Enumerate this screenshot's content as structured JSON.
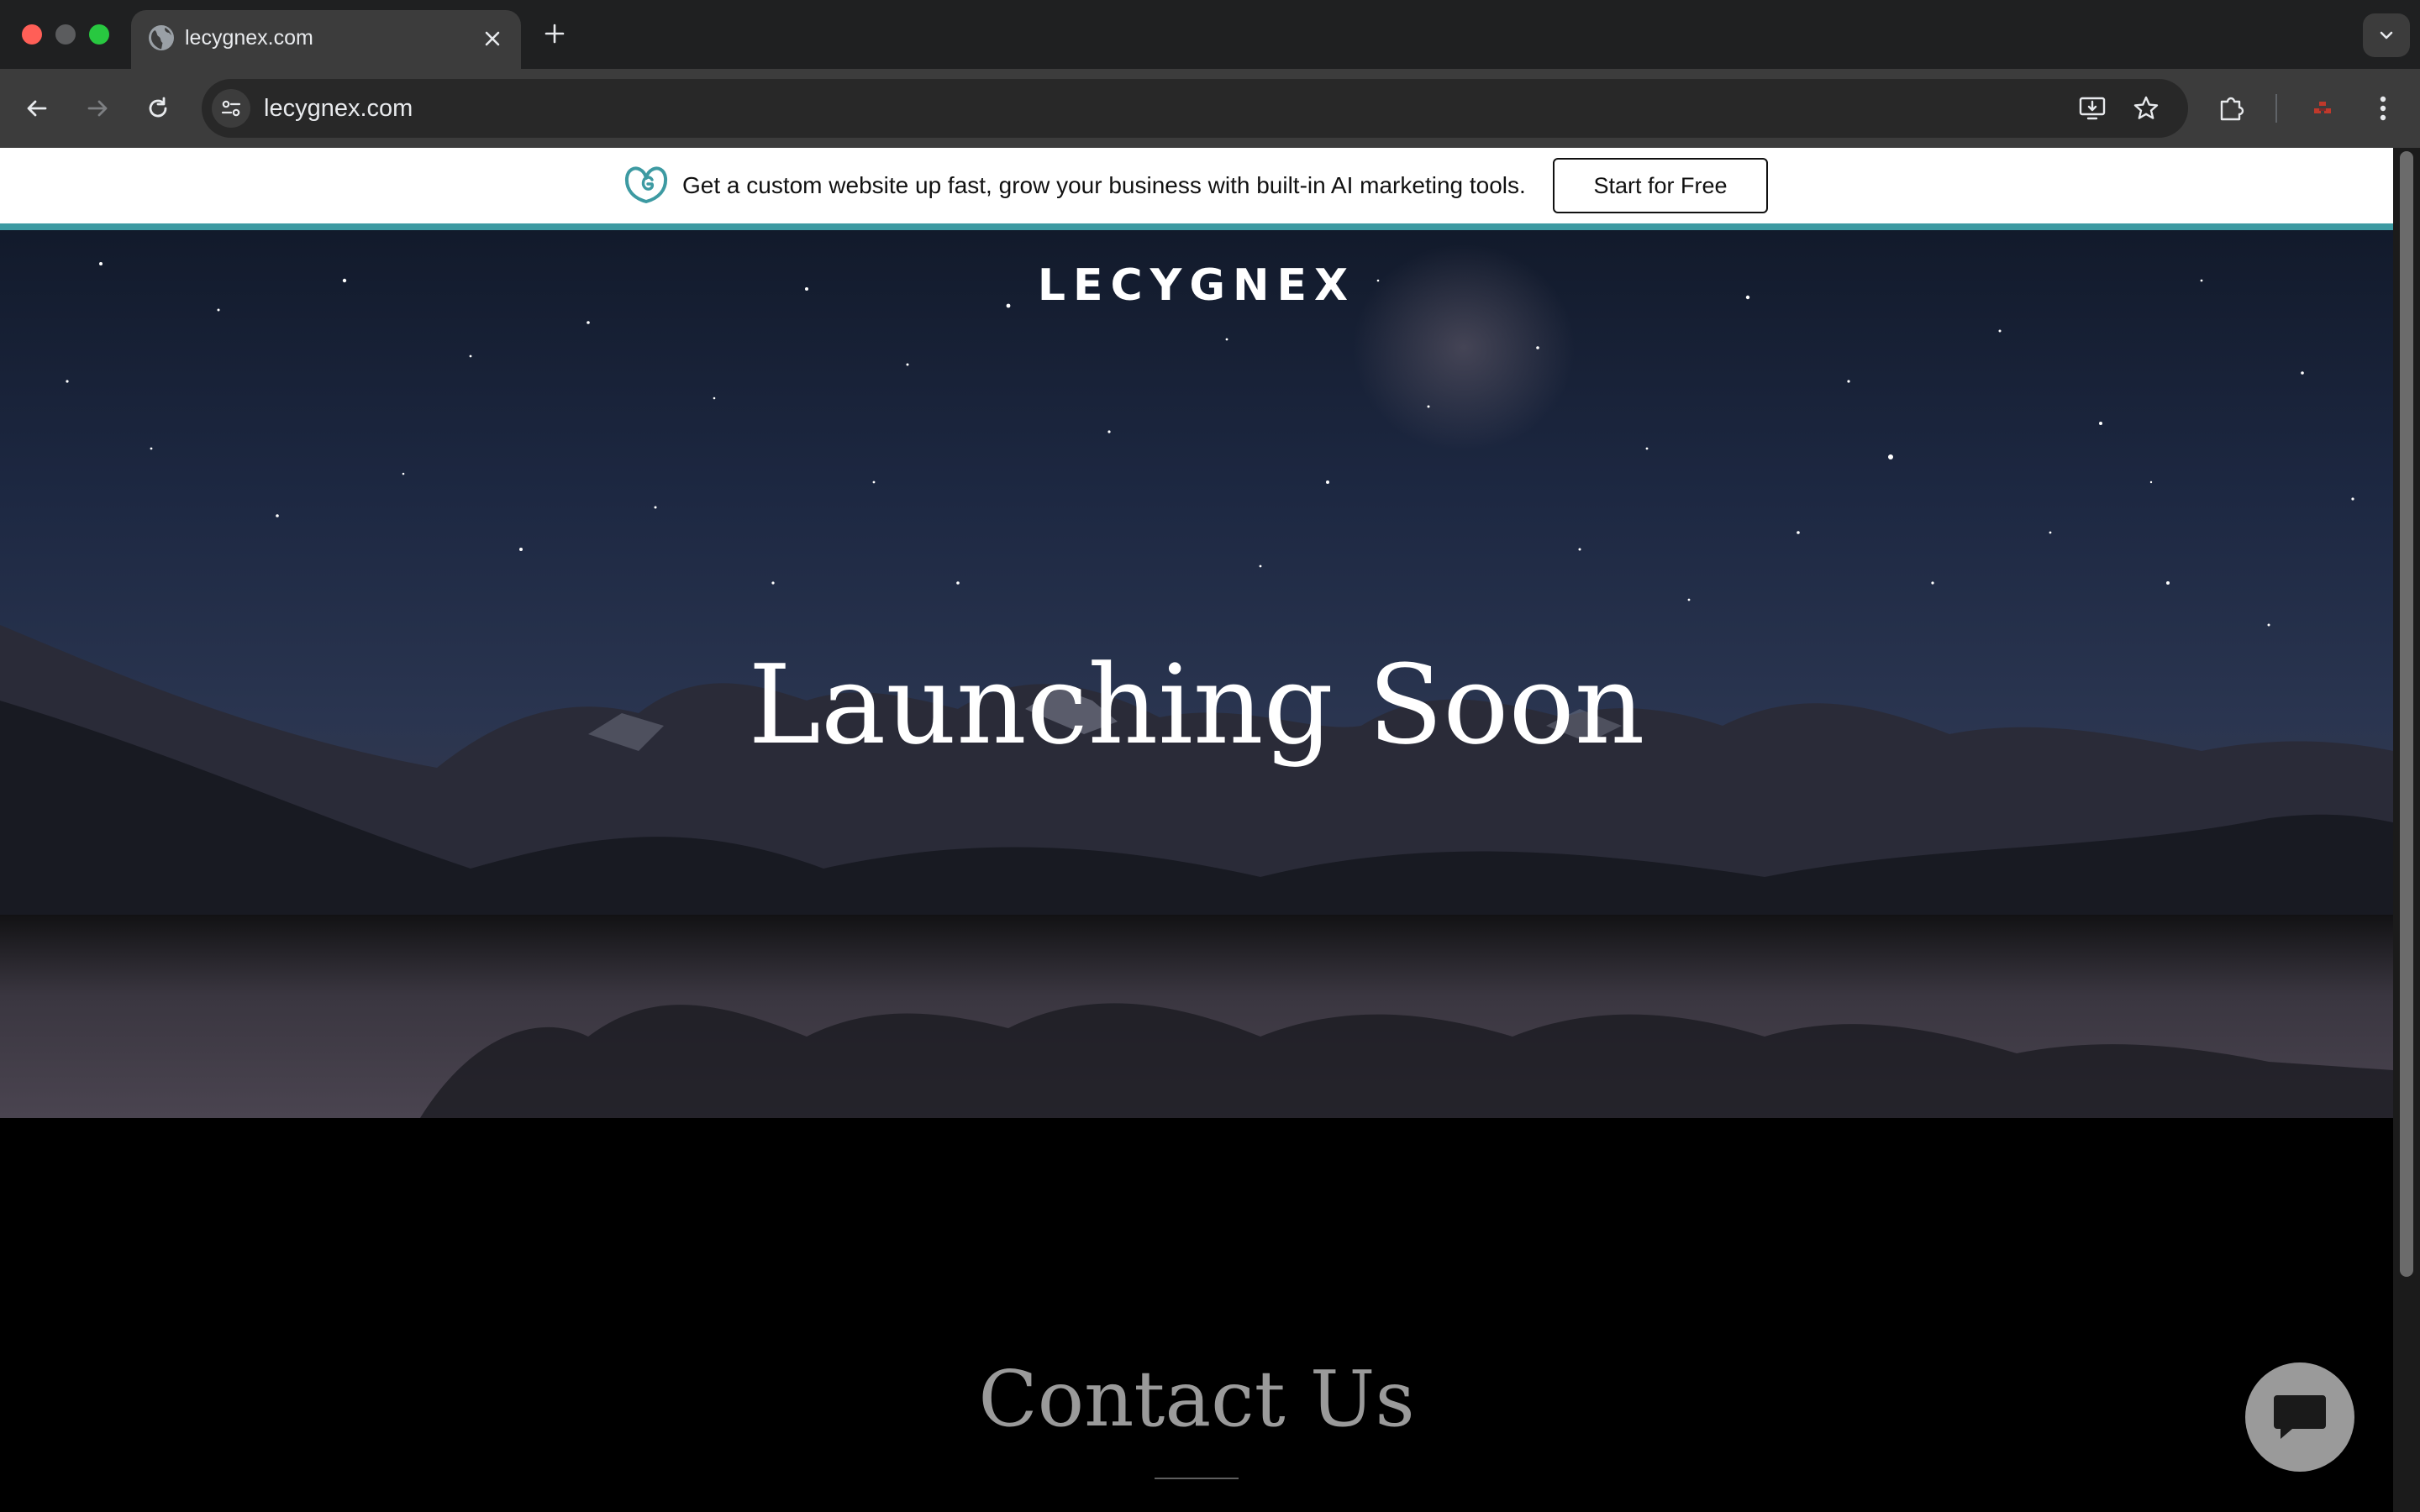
{
  "browser": {
    "tab_title": "lecygnex.com",
    "url": "lecygnex.com",
    "icons": {
      "favicon": "globe-icon",
      "tab_close": "close-icon",
      "new_tab": "plus-icon",
      "tab_list": "chevron-down-icon",
      "back": "back-arrow-icon",
      "forward": "forward-arrow-icon",
      "reload": "reload-icon",
      "site_info": "tune-icon",
      "install": "install-app-icon",
      "bookmark": "star-icon",
      "extensions": "puzzle-icon",
      "profile": "profile-icon",
      "menu": "kebab-menu-icon"
    }
  },
  "promo_banner": {
    "text": "Get a custom website up fast, grow your business with built-in AI marketing tools.",
    "cta_label": "Start for Free",
    "accent_color": "#3d9aa2"
  },
  "hero": {
    "brand": "LECYGNEX",
    "title": "Launching Soon"
  },
  "contact": {
    "title": "Contact Us"
  },
  "chat": {
    "icon": "chat-bubble-icon",
    "color": "#9a9a9a"
  }
}
